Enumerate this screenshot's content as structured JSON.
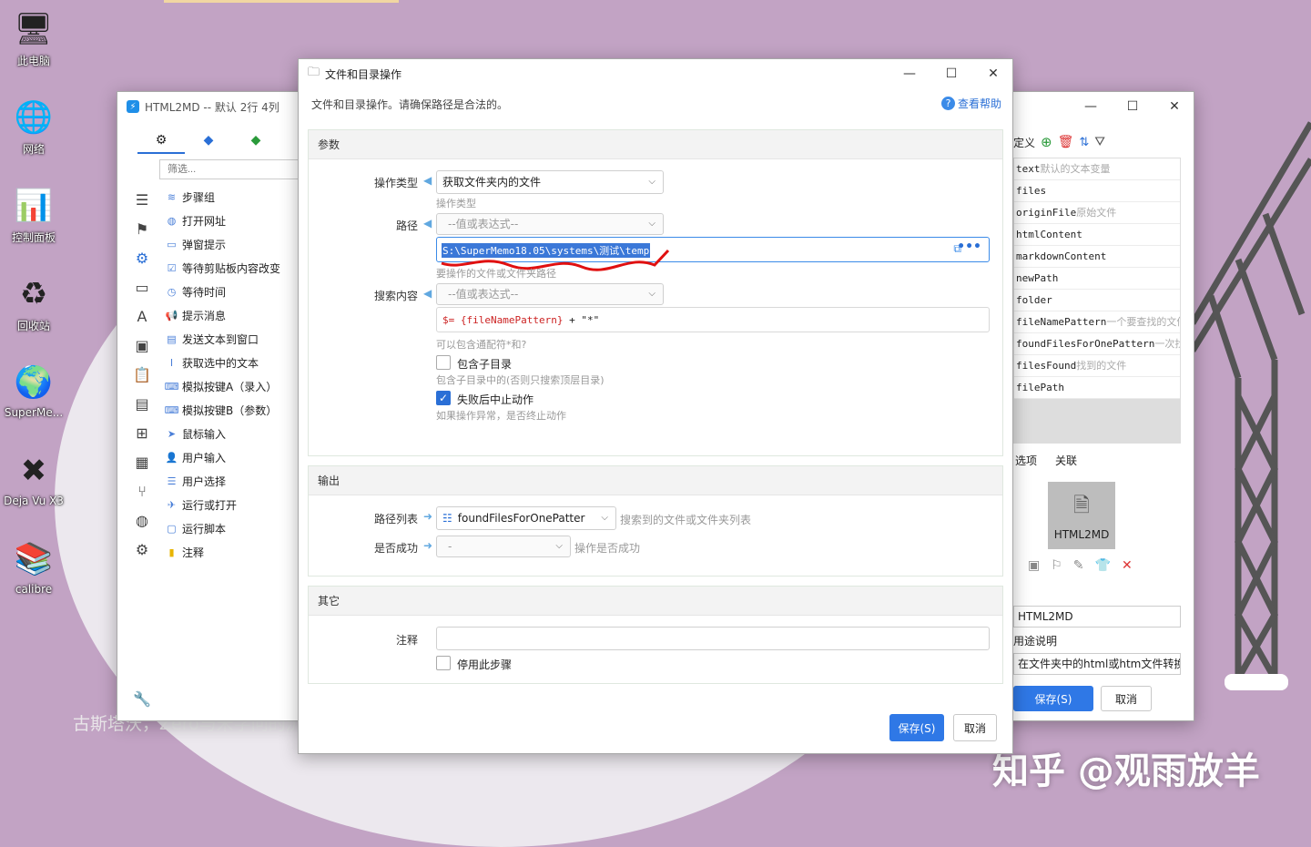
{
  "desktop": {
    "icons": [
      {
        "label": "此电脑",
        "icon": "computer-icon"
      },
      {
        "label": "网络",
        "icon": "network-icon"
      },
      {
        "label": "控制面板",
        "icon": "control-panel-icon"
      },
      {
        "label": "回收站",
        "icon": "recycle-bin-icon"
      },
      {
        "label": "SuperMe...",
        "icon": "supermemo-icon"
      },
      {
        "label": "Deja Vu X3",
        "icon": "dejavu-icon"
      },
      {
        "label": "calibre",
        "icon": "calibre-icon"
      }
    ],
    "watermark": "知乎 @观雨放羊",
    "wallpaper_text": "古斯塔沃，Zero与米字问的沉"
  },
  "back_window": {
    "title": "HTML2MD -- 默认 2行 4列",
    "filter_placeholder": "筛选...",
    "tabs": [
      "gear-icon",
      "cubes-blue-icon",
      "cubes-green-icon"
    ],
    "tree_items": [
      {
        "label": "步骤组",
        "icon": "layers-icon"
      },
      {
        "label": "打开网址",
        "icon": "globe-icon"
      },
      {
        "label": "弹窗提示",
        "icon": "popup-icon"
      },
      {
        "label": "等待剪贴板内容改变",
        "icon": "clipboard-check-icon"
      },
      {
        "label": "等待时间",
        "icon": "clock-icon"
      },
      {
        "label": "提示消息",
        "icon": "megaphone-icon"
      },
      {
        "label": "发送文本到窗口",
        "icon": "send-text-icon"
      },
      {
        "label": "获取选中的文本",
        "icon": "text-cursor-icon"
      },
      {
        "label": "模拟按键A（录入）",
        "icon": "keyboard-icon"
      },
      {
        "label": "模拟按键B（参数）",
        "icon": "keyboard-icon"
      },
      {
        "label": "鼠标输入",
        "icon": "cursor-icon"
      },
      {
        "label": "用户输入",
        "icon": "user-input-icon"
      },
      {
        "label": "用户选择",
        "icon": "list-select-icon"
      },
      {
        "label": "运行或打开",
        "icon": "paper-plane-icon"
      },
      {
        "label": "运行脚本",
        "icon": "script-icon"
      },
      {
        "label": "注释",
        "icon": "note-icon"
      }
    ],
    "right": {
      "toolbar_label": "定义",
      "variables": [
        {
          "name": "text",
          "desc": "默认的文本变量"
        },
        {
          "name": "files",
          "desc": ""
        },
        {
          "name": "originFile",
          "desc": "原始文件"
        },
        {
          "name": "htmlContent",
          "desc": ""
        },
        {
          "name": "markdownContent",
          "desc": ""
        },
        {
          "name": "newPath",
          "desc": ""
        },
        {
          "name": "folder",
          "desc": ""
        },
        {
          "name": "fileNamePattern",
          "desc": "一个要查找的文件"
        },
        {
          "name": "foundFilesForOnePattern",
          "desc": "一次找"
        },
        {
          "name": "filesFound",
          "desc": "找到的文件"
        },
        {
          "name": "filePath",
          "desc": ""
        }
      ],
      "tabs": [
        "选项",
        "关联"
      ],
      "app_name": "HTML2MD",
      "name_value": "HTML2MD",
      "desc_label": "用途说明",
      "desc_value": "在文件夹中的html或htm文件转换",
      "save_label": "保存(S)",
      "cancel_label": "取消"
    }
  },
  "dialog": {
    "title": "文件和目录操作",
    "subtitle": "文件和目录操作。请确保路径是合法的。",
    "help_label": "查看帮助",
    "params": {
      "header": "参数",
      "op_type_label": "操作类型",
      "op_type_value": "获取文件夹内的文件",
      "op_type_hint": "操作类型",
      "path_label": "路径",
      "path_mode": "--值或表达式--",
      "path_value": "S:\\SuperMemo18.05\\systems\\测试\\temp",
      "path_hint": "要操作的文件或文件夹路径",
      "search_label": "搜索内容",
      "search_mode": "--值或表达式--",
      "search_expr_prefix": "$=",
      "search_expr_var": "{fileNamePattern}",
      "search_expr_rest": "+ \"*\"",
      "search_hint": "可以包含通配符*和?",
      "include_sub_label": "包含子目录",
      "include_sub_checked": false,
      "include_sub_hint": "包含子目录中的(否则只搜索顶层目录)",
      "abort_label": "失败后中止动作",
      "abort_checked": true,
      "abort_hint": "如果操作异常，是否终止动作"
    },
    "output": {
      "header": "输出",
      "path_list_label": "路径列表",
      "path_list_value": "foundFilesForOnePatter",
      "path_list_hint": "搜索到的文件或文件夹列表",
      "success_label": "是否成功",
      "success_value": "-",
      "success_hint": "操作是否成功"
    },
    "other": {
      "header": "其它",
      "comment_label": "注释",
      "comment_value": "",
      "disable_label": "停用此步骤"
    },
    "save_label": "保存(S)",
    "cancel_label": "取消"
  },
  "colors": {
    "accent": "#2f78e6",
    "wallpaper": "#c2a3c4"
  }
}
